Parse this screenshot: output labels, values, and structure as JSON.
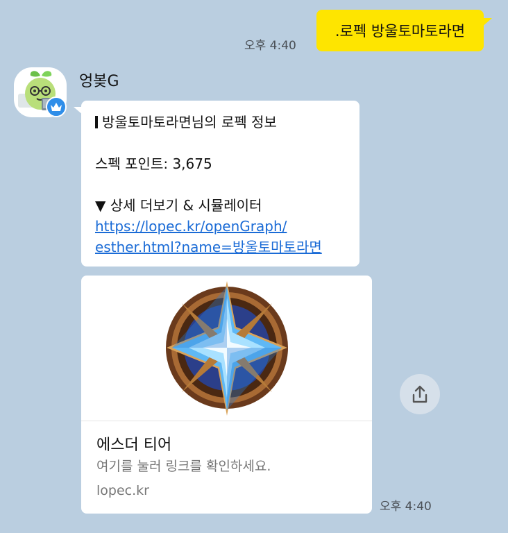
{
  "outgoing": {
    "text": ".로펙 방울토마토라면",
    "time": "오후 4:40"
  },
  "sender": {
    "name": "엉봊G",
    "avatar_icon": "sprout-character-avatar",
    "badge_icon": "crown-icon"
  },
  "incoming": {
    "line1": "방울토마토라면님의 로펙 정보",
    "line2": "스펙 포인트: 3,675",
    "line3": "▼ 상세 더보기 & 시뮬레이터",
    "link_line1": "https://lopec.kr/openGraph/",
    "link_line2": "esther.html?name=방울토마토라면"
  },
  "card": {
    "image_icon": "esther-tier-emblem",
    "title": "에스더 티어",
    "description": "여기를 눌러 링크를 확인하세요.",
    "domain": "lopec.kr",
    "time": "오후 4:40"
  },
  "share_icon": "share-icon",
  "colors": {
    "background": "#bacee0",
    "outgoing": "#fee500",
    "link": "#1a6bd6",
    "badge": "#2f8ee9"
  }
}
